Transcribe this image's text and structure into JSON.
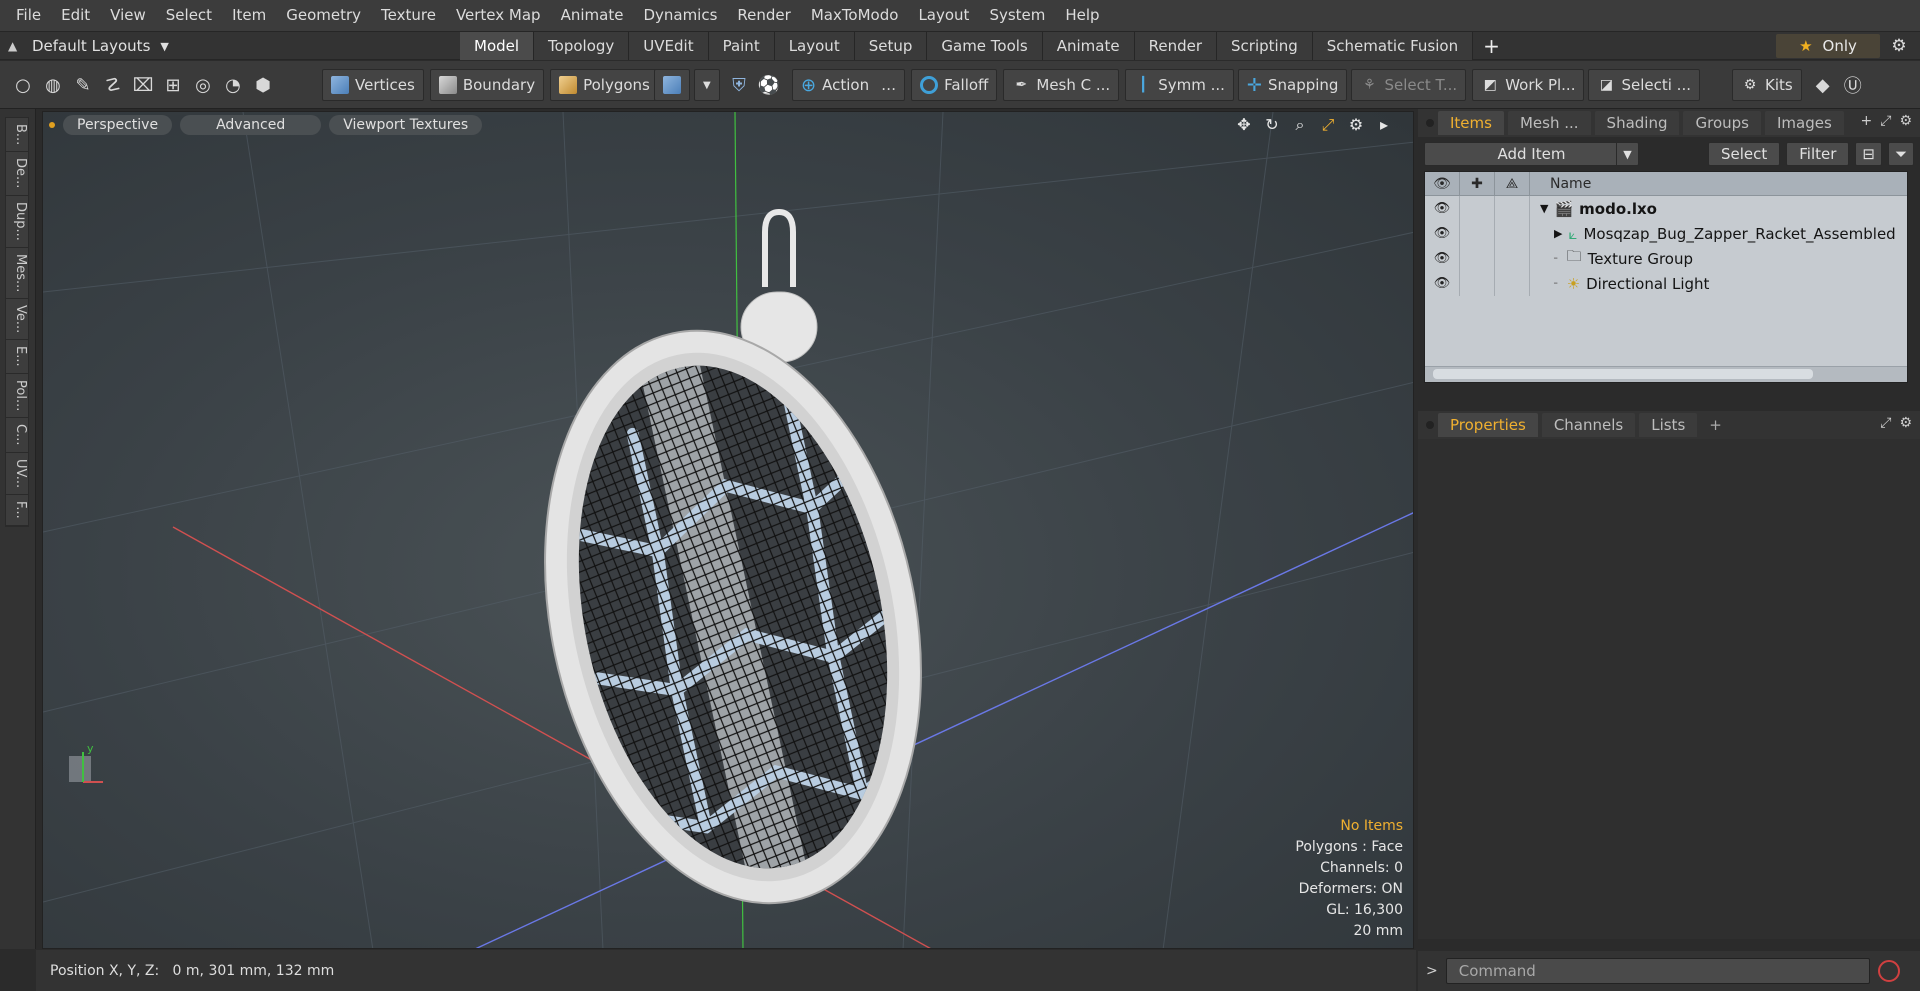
{
  "menubar": {
    "items": [
      "File",
      "Edit",
      "View",
      "Select",
      "Item",
      "Geometry",
      "Texture",
      "Vertex Map",
      "Animate",
      "Dynamics",
      "Render",
      "MaxToModo",
      "Layout",
      "System",
      "Help"
    ]
  },
  "layouts": {
    "default_label": "Default Layouts",
    "tabs": [
      "Model",
      "Topology",
      "UVEdit",
      "Paint",
      "Layout",
      "Setup",
      "Game Tools",
      "Animate",
      "Render",
      "Scripting",
      "Schematic Fusion"
    ],
    "active_tab": "Model",
    "only_label": "Only"
  },
  "toolbar": {
    "vertices": "Vertices",
    "boundary": "Boundary",
    "polygons": "Polygons",
    "action": "Action",
    "falloff": "Falloff",
    "mesh": "Mesh C ...",
    "symmetry": "Symm ...",
    "snapping": "Snapping",
    "select_through": "Select T...",
    "work_plane": "Work Pl...",
    "selection": "Selecti ...",
    "kits": "Kits"
  },
  "left_tabs": [
    "B...",
    "De...",
    "Dup...",
    "Mes...",
    "Ve...",
    "E...",
    "Pol...",
    "C...",
    "UV...",
    "F..."
  ],
  "viewport": {
    "tabs": [
      "Perspective",
      "Advanced",
      "Viewport Textures"
    ],
    "stats": {
      "items": "No Items",
      "polygons": "Polygons : Face",
      "channels": "Channels: 0",
      "deformers": "Deformers: ON",
      "gl": "GL: 16,300",
      "scale": "20 mm"
    },
    "axis_colors": {
      "x": "#d05050",
      "y": "#40c040",
      "z": "#5060e0"
    }
  },
  "status": {
    "position": "Position X, Y, Z:   0 m, 301 mm, 132 mm"
  },
  "items_panel": {
    "tabs": [
      "Items",
      "Mesh ...",
      "Shading",
      "Groups",
      "Images"
    ],
    "active_tab": "Items",
    "add_item": "Add Item",
    "select": "Select",
    "filter": "Filter",
    "name_header": "Name",
    "rows": [
      {
        "name": "modo.lxo",
        "icon": "scene-icon"
      },
      {
        "name": "Mosqzap_Bug_Zapper_Racket_Assembled",
        "icon": "locator-icon"
      },
      {
        "name": "Texture Group",
        "icon": "folder-icon"
      },
      {
        "name": "Directional Light",
        "icon": "light-icon"
      }
    ]
  },
  "properties_panel": {
    "tabs": [
      "Properties",
      "Channels",
      "Lists"
    ],
    "active_tab": "Properties"
  },
  "command": {
    "placeholder": "Command"
  }
}
